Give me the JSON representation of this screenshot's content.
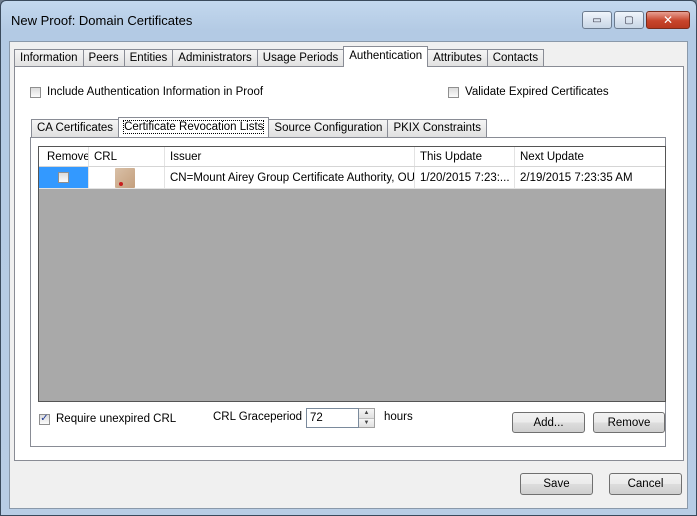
{
  "window": {
    "title": "New Proof: Domain Certificates",
    "caption_buttons": {
      "minimize": "▭",
      "maximize": "▢",
      "close": "✕"
    }
  },
  "main_tabs": [
    {
      "label": "Information",
      "active": false
    },
    {
      "label": "Peers",
      "active": false
    },
    {
      "label": "Entities",
      "active": false
    },
    {
      "label": "Administrators",
      "active": false
    },
    {
      "label": "Usage Periods",
      "active": false
    },
    {
      "label": "Authentication",
      "active": true
    },
    {
      "label": "Attributes",
      "active": false
    },
    {
      "label": "Contacts",
      "active": false
    }
  ],
  "authentication": {
    "include_auth_info": {
      "label": "Include Authentication Information in Proof",
      "checked": false
    },
    "validate_expired": {
      "label": "Validate Expired Certificates",
      "checked": false
    },
    "inner_tabs": [
      {
        "label": "CA Certificates",
        "active": false
      },
      {
        "label": "Certificate Revocation Lists",
        "active": true
      },
      {
        "label": "Source Configuration",
        "active": false
      },
      {
        "label": "PKIX Constraints",
        "active": false
      }
    ],
    "crl_grid": {
      "columns": [
        "Remove",
        "CRL",
        "Issuer",
        "This Update",
        "Next Update"
      ],
      "rows": [
        {
          "remove": false,
          "crl_icon": "certificate-icon",
          "issuer": "CN=Mount Airey Group Certificate Authority, OU=...",
          "this_update": "1/20/2015 7:23:...",
          "next_update": "2/19/2015 7:23:35 AM"
        }
      ]
    },
    "require_unexpired": {
      "label": "Require unexpired CRL",
      "checked": true
    },
    "grace_period": {
      "label": "CRL Graceperiod",
      "value": "72",
      "unit": "hours"
    },
    "add_label": "Add...",
    "remove_label": "Remove"
  },
  "footer": {
    "save_label": "Save",
    "cancel_label": "Cancel"
  },
  "colors": {
    "selection": "#3399ff",
    "grid_background": "#a9a9a9"
  }
}
